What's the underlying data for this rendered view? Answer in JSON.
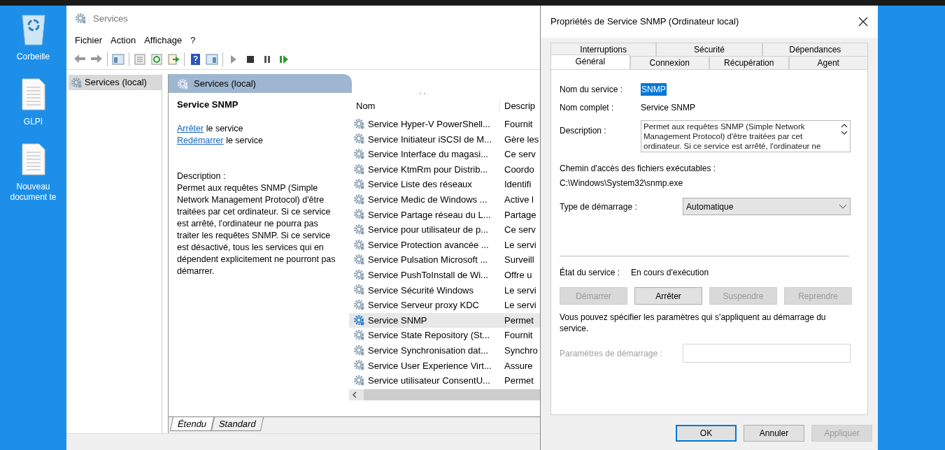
{
  "desktop": {
    "icons": [
      {
        "kind": "recycle",
        "label": "Corbeille"
      },
      {
        "kind": "document",
        "label": "GLPI"
      },
      {
        "kind": "document",
        "label": "Nouveau document te"
      }
    ]
  },
  "services_window": {
    "title": "Services",
    "menu": [
      "Fichier",
      "Action",
      "Affichage",
      "?"
    ],
    "tree": [
      {
        "label": "Services (local)",
        "selected": true
      }
    ],
    "header": "Services (local)",
    "details": {
      "title": "Service SNMP",
      "actions": [
        {
          "link": "Arrêter",
          "text": "le service"
        },
        {
          "link": "Redémarrer",
          "text": "le service"
        }
      ],
      "description_label": "Description :",
      "description": "Permet aux requêtes SNMP (Simple Network Management Protocol) d'être traitées par cet ordinateur. Si ce service est arrêté, l'ordinateur ne pourra pas traiter les requêtes SNMP. Si ce service est désactivé, tous les services qui en dépendent explicitement ne pourront pas démarrer."
    },
    "table": {
      "columns": [
        "Nom",
        "Descrip"
      ],
      "rows": [
        {
          "name": "Service Hyper-V PowerShell...",
          "description": "Fournit",
          "selected": false
        },
        {
          "name": "Service Initiateur iSCSI de M...",
          "description": "Gère les",
          "selected": false
        },
        {
          "name": "Service Interface du magasi...",
          "description": "Ce serv",
          "selected": false
        },
        {
          "name": "Service KtmRm pour Distrib...",
          "description": "Coordo",
          "selected": false
        },
        {
          "name": "Service Liste des réseaux",
          "description": "Identifi",
          "selected": false
        },
        {
          "name": "Service Medic de Windows ...",
          "description": "Active l",
          "selected": false
        },
        {
          "name": "Service Partage réseau du L...",
          "description": "Partage",
          "selected": false
        },
        {
          "name": "Service pour utilisateur de p...",
          "description": "Ce serv",
          "selected": false
        },
        {
          "name": "Service Protection avancée ...",
          "description": "Le servi",
          "selected": false
        },
        {
          "name": "Service Pulsation Microsoft ...",
          "description": "Surveill",
          "selected": false
        },
        {
          "name": "Service PushToInstall de Wi...",
          "description": "Offre u",
          "selected": false
        },
        {
          "name": "Service Sécurité Windows",
          "description": "Le servi",
          "selected": false
        },
        {
          "name": "Service Serveur proxy KDC",
          "description": "Le servi",
          "selected": false
        },
        {
          "name": "Service SNMP",
          "description": "Permet",
          "selected": true
        },
        {
          "name": "Service State Repository (St...",
          "description": "Fournit",
          "selected": false
        },
        {
          "name": "Service Synchronisation dat...",
          "description": "Synchro",
          "selected": false
        },
        {
          "name": "Service User Experience Virt...",
          "description": "Assure",
          "selected": false
        },
        {
          "name": "Service utilisateur ConsentU...",
          "description": "Permet",
          "selected": false
        }
      ]
    },
    "view_tabs": [
      {
        "label": "Étendu",
        "selected": true
      },
      {
        "label": "Standard",
        "selected": false
      }
    ]
  },
  "dialog": {
    "title": "Propriétés de Service SNMP (Ordinateur local)",
    "tab_rows": [
      [
        {
          "label": "Interruptions",
          "selected": false
        },
        {
          "label": "Sécurité",
          "selected": false
        },
        {
          "label": "Dépendances",
          "selected": false
        }
      ],
      [
        {
          "label": "Général",
          "selected": true
        },
        {
          "label": "Connexion",
          "selected": false
        },
        {
          "label": "Récupération",
          "selected": false
        },
        {
          "label": "Agent",
          "selected": false
        }
      ]
    ],
    "service_name_label": "Nom du service :",
    "service_name": "SNMP",
    "service_name_highlighted": true,
    "display_name_label": "Nom complet :",
    "display_name": "Service SNMP",
    "description_label": "Description :",
    "description": "Permet aux requêtes SNMP (Simple Network Management Protocol) d'être traitées par cet ordinateur. Si ce service est arrêté, l'ordinateur ne",
    "path_label": "Chemin d'accès des fichiers exécutables :",
    "path": "C:\\Windows\\System32\\snmp.exe",
    "startup_type_label": "Type de démarrage :",
    "startup_type": "Automatique",
    "status_label": "État du service :",
    "status": "En cours d'exécution",
    "control_buttons": [
      {
        "label": "Démarrer",
        "disabled": true
      },
      {
        "label": "Arrêter",
        "disabled": false
      },
      {
        "label": "Suspendre",
        "disabled": true
      },
      {
        "label": "Reprendre",
        "disabled": true
      }
    ],
    "note": "Vous pouvez spécifier les paramètres qui s'appliquent au démarrage du service.",
    "start_parameters": {
      "label": "Paramètres de démarrage :",
      "disabled": true
    },
    "buttons": [
      {
        "label": "OK",
        "disabled": false,
        "default": true
      },
      {
        "label": "Annuler",
        "disabled": false,
        "default": false
      },
      {
        "label": "Appliquer",
        "disabled": true,
        "default": false
      }
    ]
  }
}
